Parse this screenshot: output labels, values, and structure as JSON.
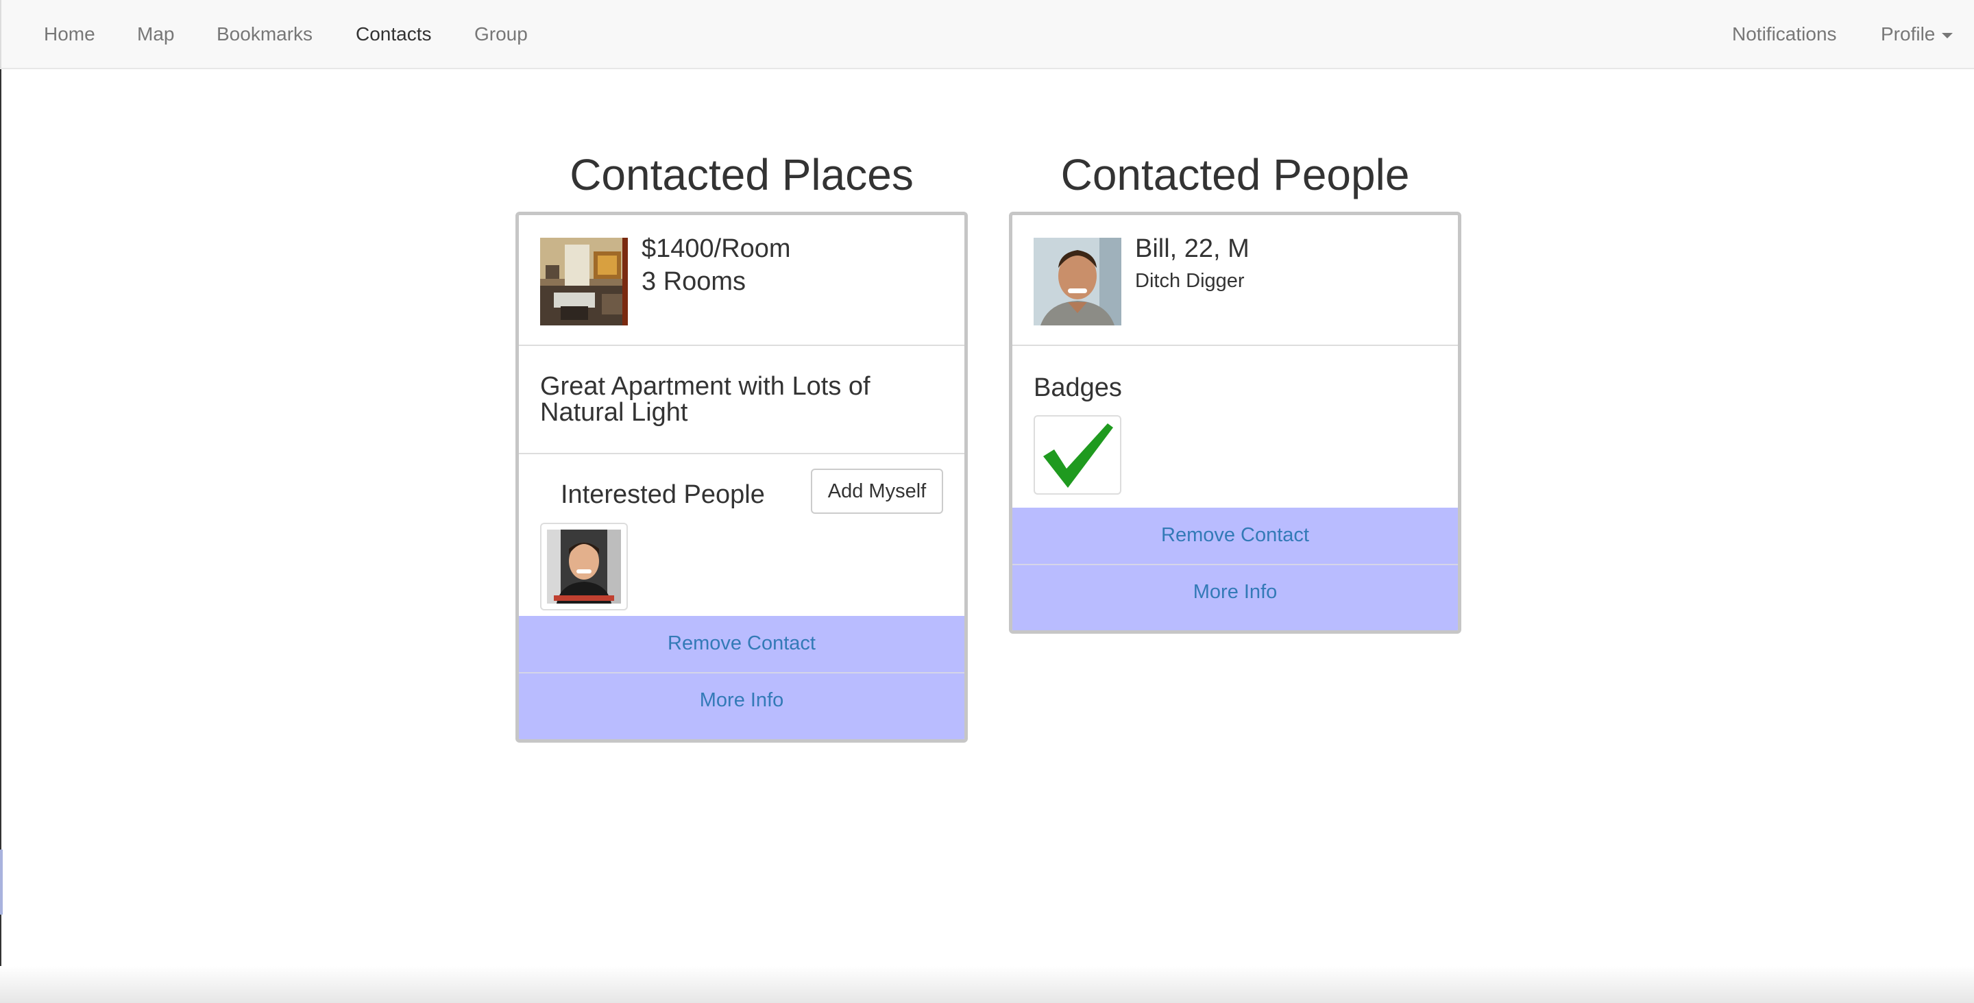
{
  "nav": {
    "left": [
      "Home",
      "Map",
      "Bookmarks",
      "Contacts",
      "Group"
    ],
    "active": "Contacts",
    "notifications": "Notifications",
    "profile": "Profile"
  },
  "places": {
    "title": "Contacted Places",
    "price": "$1400/Room",
    "rooms": "3 Rooms",
    "description": "Great Apartment with Lots of Natural Light",
    "interested_label": "Interested People",
    "add_button": "Add Myself",
    "remove_label": "Remove Contact",
    "more_label": "More Info"
  },
  "people": {
    "title": "Contacted People",
    "name_line": "Bill, 22, M",
    "occupation": "Ditch Digger",
    "badges_label": "Badges",
    "badge_icon": "checkmark-icon",
    "remove_label": "Remove Contact",
    "more_label": "More Info"
  },
  "colors": {
    "action_bar": "#b9bcff",
    "link": "#337ab7",
    "badge_check": "#1f9a1f"
  }
}
